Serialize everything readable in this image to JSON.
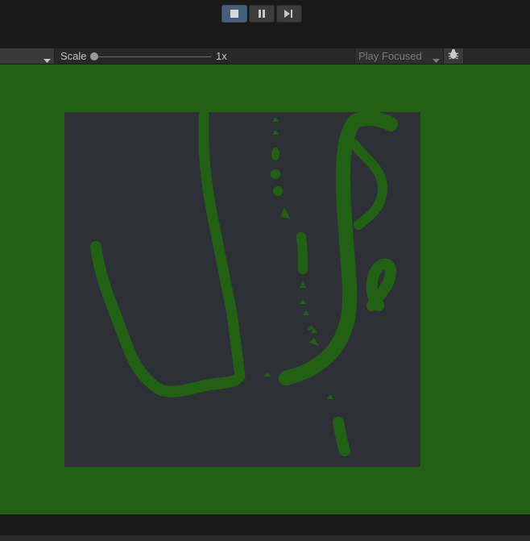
{
  "play_controls": {
    "stop_icon": "stop-icon",
    "pause_icon": "pause-icon",
    "step_icon": "step-forward-icon"
  },
  "toolbar": {
    "display_dropdown_icon": "chevron-down-icon",
    "scale_label": "Scale",
    "scale_value": "1x",
    "scale_level": 0,
    "play_mode": "Play Focused",
    "debug_icon": "bug-icon"
  },
  "game_view": {
    "background_color": "#226114",
    "canvas_color": "#2e3038",
    "stroke_color": "#226114"
  }
}
